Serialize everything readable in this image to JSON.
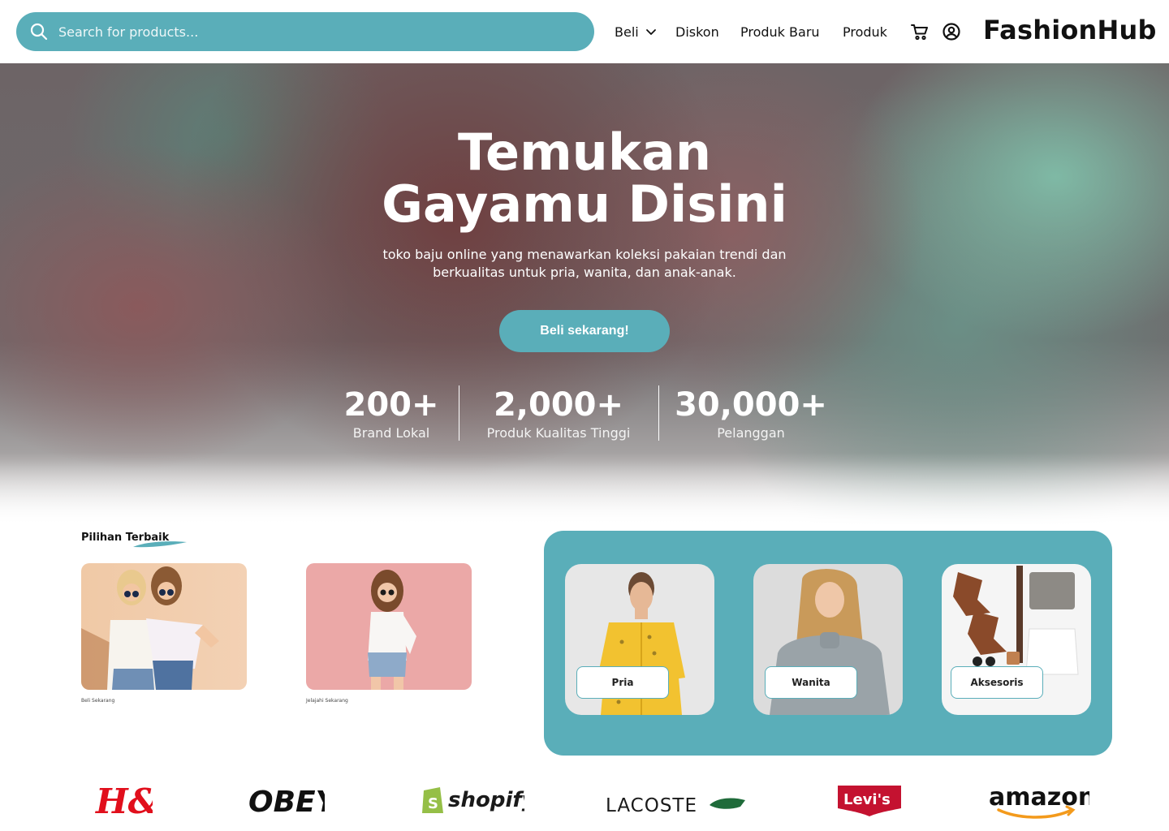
{
  "header": {
    "search_placeholder": "Search for products...",
    "nav": [
      {
        "label": "Beli",
        "has_dropdown": true
      },
      {
        "label": "Diskon"
      },
      {
        "label": "Produk Baru"
      },
      {
        "label": "Produk"
      }
    ],
    "brand": "FashionHub",
    "icons": [
      "search-icon",
      "chevron-down-icon",
      "cart-icon",
      "user-icon"
    ]
  },
  "hero": {
    "title_line1": "Temukan",
    "title_line2": "Gayamu Disini",
    "subtitle": "toko baju online yang menawarkan koleksi pakaian trendi dan berkualitas untuk pria, wanita, dan anak-anak.",
    "cta": "Beli sekarang!",
    "stats": [
      {
        "value": "200+",
        "label": "Brand Lokal"
      },
      {
        "value": "2,000+",
        "label": "Produk Kualitas Tinggi"
      },
      {
        "value": "30,000+",
        "label": "Pelanggan"
      }
    ]
  },
  "picks": {
    "title": "Pilihan Terbaik",
    "items": [
      {
        "caption": "Beli Sekarang"
      },
      {
        "caption": "Jelajahi Sekarang"
      }
    ]
  },
  "categories": [
    {
      "label": "Pria"
    },
    {
      "label": "Wanita"
    },
    {
      "label": "Aksesoris"
    }
  ],
  "brands": [
    "H&M",
    "OBEY",
    "shopify",
    "LACOSTE",
    "Levi's",
    "amazon"
  ],
  "colors": {
    "accent": "#5aaeb9",
    "text": "#111111",
    "white": "#ffffff"
  }
}
